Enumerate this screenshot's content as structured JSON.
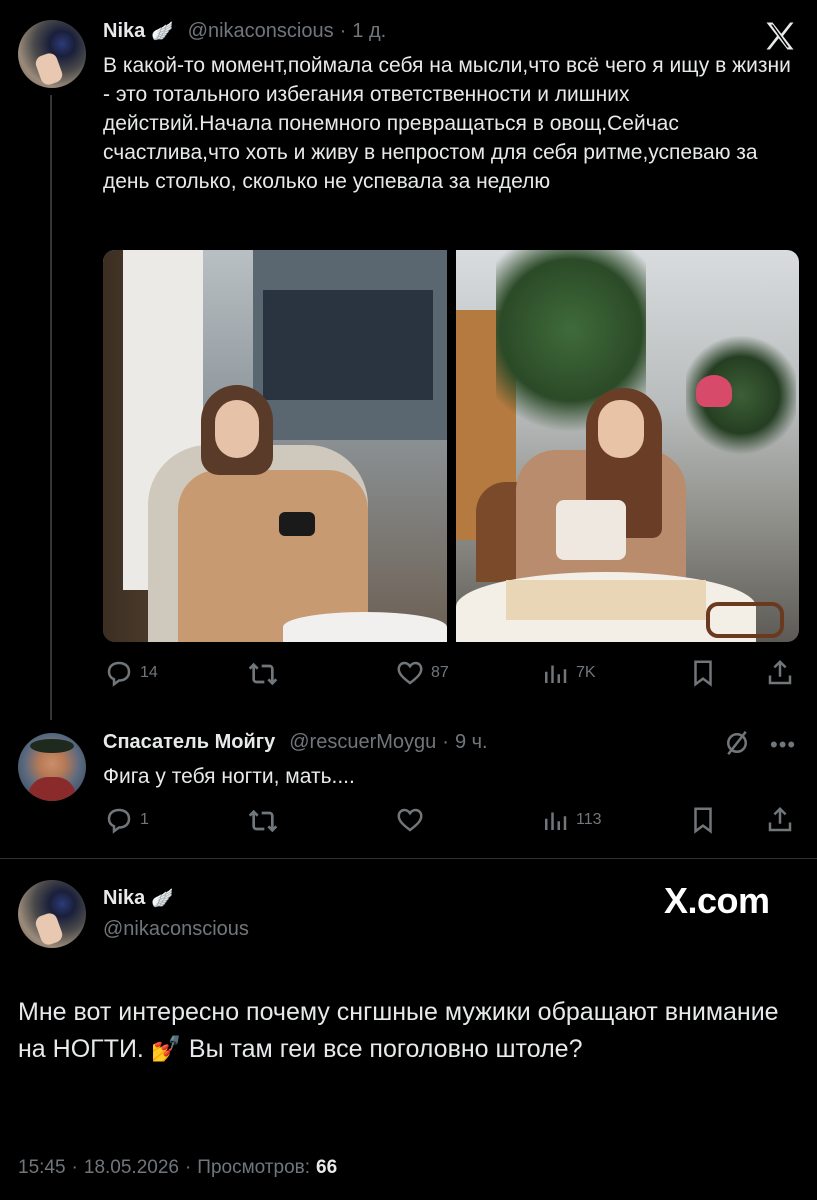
{
  "tweet1": {
    "author_name": "Nika",
    "author_handle": "@nikaconscious",
    "age": "1 д.",
    "text": "В какой-то момент,поймала себя на мысли,что всё чего я ищу в жизни - это тотального избегания ответственности и лишних действий.Начала понемного превращаться в овощ.Сейчас счастлива,что хоть и живу в непростом для себя ритме,успеваю за день столько, сколько не успевала за неделю",
    "replies": "14",
    "likes": "87",
    "views": "7K"
  },
  "tweet2": {
    "author_name": "Спасатель Мойгу",
    "author_handle": "@rescuerMoygu",
    "age": "9 ч.",
    "text": "Фига у тебя ногти, мать....",
    "replies": "1",
    "views": "113"
  },
  "tweet3": {
    "author_name": "Nika",
    "author_handle": "@nikaconscious",
    "text": "Мне вот интересно почему снгшные мужики обращают внимание на НОГТИ. 💅 Вы там геи все поголовно штоле?",
    "time": "15:45",
    "date": "18.05.2026",
    "views_label": "Просмотров:",
    "views_count": "66"
  },
  "watermark": "X.com",
  "separator": "·",
  "colors": {
    "background": "#000000",
    "text": "#e7e9ea",
    "muted": "#71767b",
    "line": "#333639"
  }
}
